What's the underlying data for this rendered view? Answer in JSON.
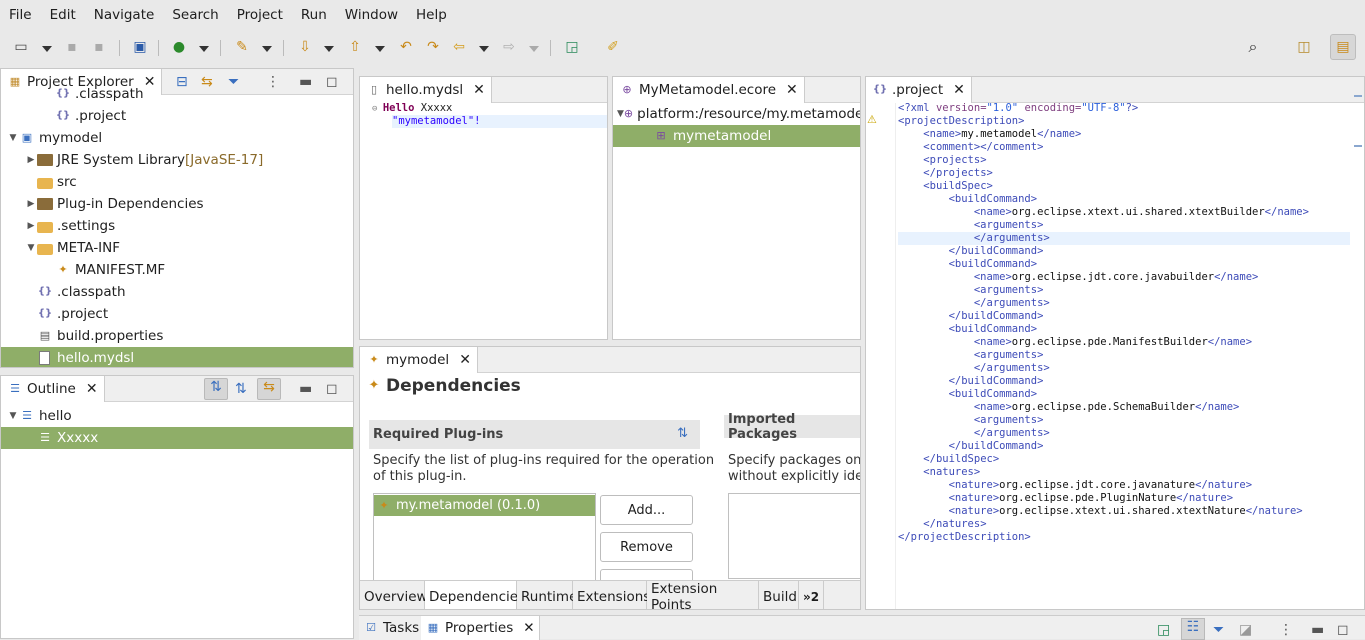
{
  "menu": [
    "File",
    "Edit",
    "Navigate",
    "Search",
    "Project",
    "Run",
    "Window",
    "Help"
  ],
  "project_explorer": {
    "title": "Project Explorer",
    "rows": [
      {
        "label": ".classpath",
        "indent": 2,
        "icon": "xml"
      },
      {
        "label": ".project",
        "indent": 2,
        "icon": "xml"
      },
      {
        "label": "mymodel",
        "indent": 0,
        "icon": "project",
        "twisty": "open"
      },
      {
        "label": "JRE System Library",
        "suffix": "[JavaSE-17]",
        "indent": 1,
        "icon": "lib",
        "twisty": "closed"
      },
      {
        "label": "src",
        "indent": 1,
        "icon": "src-folder"
      },
      {
        "label": "Plug-in Dependencies",
        "indent": 1,
        "icon": "lib",
        "twisty": "closed"
      },
      {
        "label": ".settings",
        "indent": 1,
        "icon": "folder",
        "twisty": "closed"
      },
      {
        "label": "META-INF",
        "indent": 1,
        "icon": "folder",
        "twisty": "open"
      },
      {
        "label": "MANIFEST.MF",
        "indent": 2,
        "icon": "manifest"
      },
      {
        "label": ".classpath",
        "indent": 1,
        "icon": "xml"
      },
      {
        "label": ".project",
        "indent": 1,
        "icon": "xml"
      },
      {
        "label": "build.properties",
        "indent": 1,
        "icon": "props"
      },
      {
        "label": "hello.mydsl",
        "indent": 1,
        "icon": "file",
        "selected": true
      }
    ]
  },
  "outline": {
    "title": "Outline",
    "rows": [
      {
        "label": "hello",
        "indent": 0,
        "twisty": "open"
      },
      {
        "label": "Xxxxx",
        "indent": 1,
        "selected": true
      }
    ]
  },
  "mydsl_editor": {
    "tab": "hello.mydsl",
    "line1_kw": "Hello",
    "line1_rest": " Xxxxx",
    "line2": "\"mymetamodel\"!"
  },
  "ecore_editor": {
    "tab": "MyMetamodel.ecore",
    "root": "platform:/resource/my.metamodel/",
    "child": "mymetamodel"
  },
  "manifest_editor": {
    "tab": "mymodel",
    "heading": "Dependencies",
    "required_title": "Required Plug-ins",
    "required_desc_1": "Specify the list of plug-ins required for the operation",
    "required_desc_2": "of this plug-in.",
    "required_item": "my.metamodel (0.1.0)",
    "add_button": "Add...",
    "remove_button": "Remove",
    "imported_title": "Imported Packages",
    "imported_desc_1": "Specify packages on w",
    "imported_desc_2": "without explicitly iden",
    "pages": [
      "Overview",
      "Dependencies",
      "Runtime",
      "Extensions",
      "Extension Points",
      "Build"
    ],
    "more_pages": "»2"
  },
  "project_xml": {
    "tab": ".project",
    "lines": [
      {
        "i": 0,
        "t": "pi",
        "v": "<?xml version=\"1.0\" encoding=\"UTF-8\"?>"
      },
      {
        "i": 0,
        "t": "open",
        "tag": "projectDescription"
      },
      {
        "i": 1,
        "t": "elem",
        "tag": "name",
        "text": "my.metamodel"
      },
      {
        "i": 1,
        "t": "elem",
        "tag": "comment",
        "text": ""
      },
      {
        "i": 1,
        "t": "open",
        "tag": "projects"
      },
      {
        "i": 1,
        "t": "close",
        "tag": "projects"
      },
      {
        "i": 1,
        "t": "open",
        "tag": "buildSpec"
      },
      {
        "i": 2,
        "t": "open",
        "tag": "buildCommand"
      },
      {
        "i": 3,
        "t": "elem",
        "tag": "name",
        "text": "org.eclipse.xtext.ui.shared.xtextBuilder"
      },
      {
        "i": 3,
        "t": "open",
        "tag": "arguments"
      },
      {
        "i": 3,
        "t": "close",
        "tag": "arguments",
        "hl": true
      },
      {
        "i": 2,
        "t": "close",
        "tag": "buildCommand"
      },
      {
        "i": 2,
        "t": "open",
        "tag": "buildCommand"
      },
      {
        "i": 3,
        "t": "elem",
        "tag": "name",
        "text": "org.eclipse.jdt.core.javabuilder"
      },
      {
        "i": 3,
        "t": "open",
        "tag": "arguments"
      },
      {
        "i": 3,
        "t": "close",
        "tag": "arguments"
      },
      {
        "i": 2,
        "t": "close",
        "tag": "buildCommand"
      },
      {
        "i": 2,
        "t": "open",
        "tag": "buildCommand"
      },
      {
        "i": 3,
        "t": "elem",
        "tag": "name",
        "text": "org.eclipse.pde.ManifestBuilder"
      },
      {
        "i": 3,
        "t": "open",
        "tag": "arguments"
      },
      {
        "i": 3,
        "t": "close",
        "tag": "arguments"
      },
      {
        "i": 2,
        "t": "close",
        "tag": "buildCommand"
      },
      {
        "i": 2,
        "t": "open",
        "tag": "buildCommand"
      },
      {
        "i": 3,
        "t": "elem",
        "tag": "name",
        "text": "org.eclipse.pde.SchemaBuilder"
      },
      {
        "i": 3,
        "t": "open",
        "tag": "arguments"
      },
      {
        "i": 3,
        "t": "close",
        "tag": "arguments"
      },
      {
        "i": 2,
        "t": "close",
        "tag": "buildCommand"
      },
      {
        "i": 1,
        "t": "close",
        "tag": "buildSpec"
      },
      {
        "i": 1,
        "t": "open",
        "tag": "natures"
      },
      {
        "i": 2,
        "t": "elem",
        "tag": "nature",
        "text": "org.eclipse.jdt.core.javanature"
      },
      {
        "i": 2,
        "t": "elem",
        "tag": "nature",
        "text": "org.eclipse.pde.PluginNature"
      },
      {
        "i": 2,
        "t": "elem",
        "tag": "nature",
        "text": "org.eclipse.xtext.ui.shared.xtextNature"
      },
      {
        "i": 1,
        "t": "close",
        "tag": "natures"
      },
      {
        "i": 0,
        "t": "close",
        "tag": "projectDescription"
      }
    ]
  },
  "bottom": {
    "tabs": [
      "Tasks",
      "Properties"
    ]
  },
  "colors": {
    "selection": "#8fae68",
    "tag": "#3d4bb8",
    "keyword": "#7f0055",
    "string": "#2a00ff"
  }
}
